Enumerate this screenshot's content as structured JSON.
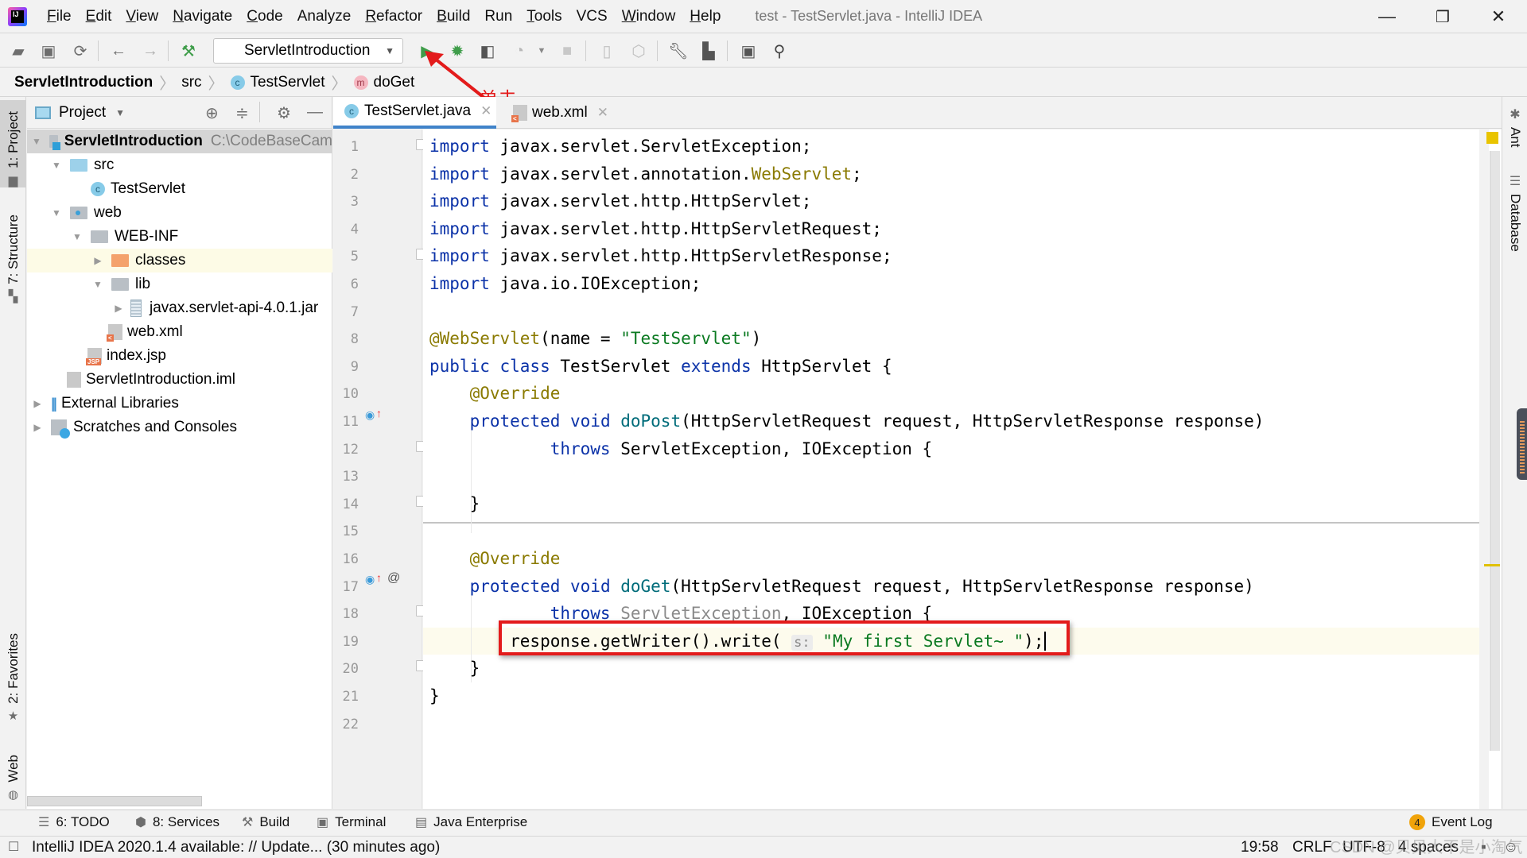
{
  "window": {
    "title": "test - TestServlet.java - IntelliJ IDEA",
    "app_logo": "IJ",
    "controls": {
      "minimize": "—",
      "restore": "❐",
      "close": "✕"
    }
  },
  "menu": [
    {
      "label": "File",
      "mnemonic": "F",
      "rest": "ile"
    },
    {
      "label": "Edit",
      "mnemonic": "E",
      "rest": "dit"
    },
    {
      "label": "View",
      "mnemonic": "V",
      "rest": "iew"
    },
    {
      "label": "Navigate",
      "mnemonic": "N",
      "rest": "avigate"
    },
    {
      "label": "Code",
      "mnemonic": "C",
      "rest": "ode"
    },
    {
      "label": "Analyze",
      "mnemonic": "",
      "rest": "Analyze"
    },
    {
      "label": "Refactor",
      "mnemonic": "R",
      "rest": "efactor"
    },
    {
      "label": "Build",
      "mnemonic": "B",
      "rest": "uild"
    },
    {
      "label": "Run",
      "mnemonic": "",
      "rest": "Run"
    },
    {
      "label": "Tools",
      "mnemonic": "T",
      "rest": "ools"
    },
    {
      "label": "VCS",
      "mnemonic": "",
      "rest": "VCS"
    },
    {
      "label": "Window",
      "mnemonic": "W",
      "rest": "indow"
    },
    {
      "label": "Help",
      "mnemonic": "H",
      "rest": "elp"
    }
  ],
  "toolbar": {
    "run_config": "ServletIntroduction",
    "icons": {
      "open": "folder-open-icon",
      "save": "save-icon",
      "sync": "sync-icon",
      "back": "back-arrow-icon",
      "forward": "forward-arrow-icon",
      "build": "hammer-icon",
      "run": "run-icon",
      "debug": "debug-icon",
      "coverage": "coverage-icon",
      "profile": "profile-icon",
      "stop": "stop-icon",
      "device": "device-icon",
      "deploy": "deploy-icon",
      "settings": "wrench-icon",
      "structure": "project-structure-icon",
      "terminal": "terminal-icon",
      "search": "search-icon"
    }
  },
  "annotation": {
    "text": "单击~",
    "color": "#e31b1b"
  },
  "breadcrumb": [
    {
      "label": "ServletIntroduction",
      "bold": true
    },
    {
      "label": "src"
    },
    {
      "label": "TestServlet",
      "badge": "c"
    },
    {
      "label": "doGet",
      "badge": "m"
    }
  ],
  "left_stripe": [
    {
      "label": "1: Project",
      "icon": "folder-icon"
    },
    {
      "label": "7: Structure",
      "icon": "structure-icon"
    },
    {
      "label": "2: Favorites",
      "icon": "star-icon"
    },
    {
      "label": "Web",
      "icon": "globe-icon"
    }
  ],
  "right_stripe": [
    {
      "label": "Ant",
      "icon": "ant-icon"
    },
    {
      "label": "Database",
      "icon": "database-icon"
    }
  ],
  "project_panel": {
    "title": "Project",
    "tree": [
      {
        "label": "ServletIntroduction",
        "extra": "C:\\CodeBaseCam",
        "depth": 0,
        "expanded": true,
        "icon": "module",
        "bold": true,
        "selected": true
      },
      {
        "label": "src",
        "depth": 1,
        "expanded": true,
        "icon": "folder-blue"
      },
      {
        "label": "TestServlet",
        "depth": 2,
        "icon": "class"
      },
      {
        "label": "web",
        "depth": 1,
        "expanded": true,
        "icon": "folder-web"
      },
      {
        "label": "WEB-INF",
        "depth": 2,
        "expanded": true,
        "icon": "folder-grey"
      },
      {
        "label": "classes",
        "depth": 3,
        "expanded": false,
        "icon": "folder-orange",
        "highlight": true
      },
      {
        "label": "lib",
        "depth": 3,
        "expanded": true,
        "icon": "folder-grey"
      },
      {
        "label": "javax.servlet-api-4.0.1.jar",
        "depth": 4,
        "expanded": false,
        "icon": "jar"
      },
      {
        "label": "web.xml",
        "depth": 3,
        "icon": "xml"
      },
      {
        "label": "index.jsp",
        "depth": 2,
        "icon": "jsp"
      },
      {
        "label": "ServletIntroduction.iml",
        "depth": 1,
        "icon": "iml"
      },
      {
        "label": "External Libraries",
        "depth": 0,
        "expanded": false,
        "icon": "libs"
      },
      {
        "label": "Scratches and Consoles",
        "depth": 0,
        "expanded": false,
        "icon": "scratch"
      }
    ]
  },
  "editor": {
    "tabs": [
      {
        "label": "TestServlet.java",
        "active": true,
        "icon": "class"
      },
      {
        "label": "web.xml",
        "active": false,
        "icon": "xml"
      }
    ],
    "line_numbers": [
      "1",
      "2",
      "3",
      "4",
      "5",
      "6",
      "7",
      "8",
      "9",
      "10",
      "11",
      "12",
      "13",
      "14",
      "15",
      "16",
      "17",
      "18",
      "19",
      "20",
      "21",
      "22"
    ],
    "lines": [
      [
        {
          "t": "import ",
          "c": "kw"
        },
        {
          "t": "javax.servlet.ServletException;"
        }
      ],
      [
        {
          "t": "import ",
          "c": "kw"
        },
        {
          "t": "javax.servlet.annotation."
        },
        {
          "t": "WebServlet",
          "c": "ann"
        },
        {
          "t": ";"
        }
      ],
      [
        {
          "t": "import ",
          "c": "kw"
        },
        {
          "t": "javax.servlet.http.HttpServlet;"
        }
      ],
      [
        {
          "t": "import ",
          "c": "kw"
        },
        {
          "t": "javax.servlet.http.HttpServletRequest;"
        }
      ],
      [
        {
          "t": "import ",
          "c": "kw"
        },
        {
          "t": "javax.servlet.http.HttpServletResponse;"
        }
      ],
      [
        {
          "t": "import ",
          "c": "kw"
        },
        {
          "t": "java.io.IOException;"
        }
      ],
      [],
      [
        {
          "t": "@WebServlet",
          "c": "ann"
        },
        {
          "t": "(name = "
        },
        {
          "t": "\"TestServlet\"",
          "c": "str"
        },
        {
          "t": ")"
        }
      ],
      [
        {
          "t": "public class ",
          "c": "kw"
        },
        {
          "t": "TestServlet "
        },
        {
          "t": "extends ",
          "c": "kw"
        },
        {
          "t": "HttpServlet {"
        }
      ],
      [
        {
          "t": "    "
        },
        {
          "t": "@Override",
          "c": "ann"
        }
      ],
      [
        {
          "t": "    "
        },
        {
          "t": "protected void ",
          "c": "kw"
        },
        {
          "t": "doPost",
          "c": "meth"
        },
        {
          "t": "(HttpServletRequest request, HttpServletResponse response)"
        }
      ],
      [
        {
          "t": "            "
        },
        {
          "t": "throws ",
          "c": "kw"
        },
        {
          "t": "ServletException, IOException {"
        }
      ],
      [],
      [
        {
          "t": "    }"
        }
      ],
      [],
      [
        {
          "t": "    "
        },
        {
          "t": "@Override",
          "c": "ann"
        }
      ],
      [
        {
          "t": "    "
        },
        {
          "t": "protected void ",
          "c": "kw"
        },
        {
          "t": "doGet",
          "c": "meth"
        },
        {
          "t": "(HttpServletRequest request, HttpServletResponse response)"
        }
      ],
      [
        {
          "t": "            "
        },
        {
          "t": "throws ",
          "c": "kw"
        },
        {
          "t": "ServletException",
          "c": "unused"
        },
        {
          "t": ", IOException {"
        }
      ],
      [
        {
          "t": "        response.getWriter().write( "
        },
        {
          "t": "s:",
          "c": "hint"
        },
        {
          "t": " "
        },
        {
          "t": "\"My first Servlet~ \"",
          "c": "str"
        },
        {
          "t": ");"
        }
      ],
      [
        {
          "t": "    }"
        }
      ],
      [
        {
          "t": "}"
        }
      ],
      []
    ],
    "caret_line": 19,
    "highlighted_line": 19,
    "highlight_color": "#e31b1b"
  },
  "bottom_tools": [
    {
      "label": "6: TODO",
      "icon": "list-icon"
    },
    {
      "label": "8: Services",
      "icon": "services-icon"
    },
    {
      "label": "Build",
      "icon": "hammer-icon"
    },
    {
      "label": "Terminal",
      "icon": "terminal-icon"
    },
    {
      "label": "Java Enterprise",
      "icon": "java-enterprise-icon"
    }
  ],
  "event_log": {
    "label": "Event Log",
    "count": "4"
  },
  "status": {
    "message": "IntelliJ IDEA 2020.1.4 available: // Update... (30 minutes ago)",
    "position": "19:58",
    "line_sep": "CRLF",
    "encoding": "UTF-8",
    "indent": "4 spaces"
  },
  "watermark": "CSDN @贝贝大不是小淘气"
}
